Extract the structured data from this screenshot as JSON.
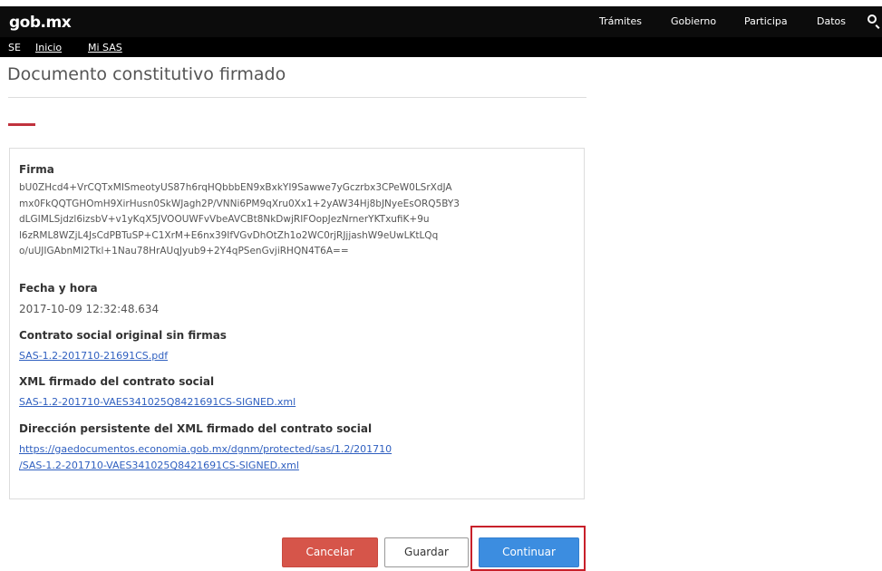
{
  "header": {
    "logo": "gob.mx",
    "nav": [
      "Trámites",
      "Gobierno",
      "Participa",
      "Datos"
    ],
    "search_icon": "search-icon"
  },
  "subheader": {
    "section": "SE",
    "links": [
      "Inicio",
      "Mi SAS"
    ]
  },
  "page": {
    "title": "Documento constitutivo firmado"
  },
  "card": {
    "firma_label": "Firma",
    "firma_value": "bU0ZHcd4+VrCQTxMISmeotyUS87h6rqHQbbbEN9xBxkYI9Sawwe7yGczrbx3CPeW0LSrXdJA\nmx0FkQQTGHOmH9XirHusn0SkWJagh2P/VNNi6PM9qXru0Xx1+2yAW34Hj8bJNyeEsORQ5BY3\ndLGIMLSjdzl6izsbV+v1yKqX5JVOOUWFvVbeAVCBt8NkDwjRIFOopJezNrnerYKTxufiK+9u\nl6zRML8WZjL4JsCdPBTuSP+C1XrM+E6nx39IfVGvDhOtZh1o2WC0rjRJjjashW9eUwLKtLQq\no/uUJIGAbnMI2Tkl+1Nau78HrAUqJyub9+2Y4qPSenGvjiRHQN4T6A==",
    "fecha_label": "Fecha y hora",
    "fecha_value": "2017-10-09 12:32:48.634",
    "contrato_label": "Contrato social original sin firmas",
    "contrato_link": "SAS-1.2-201710-21691CS.pdf",
    "xml_label": "XML firmado del contrato social",
    "xml_link": "SAS-1.2-201710-VAES341025Q8421691CS-SIGNED.xml",
    "direccion_label": "Dirección persistente del XML firmado del contrato social",
    "direccion_link": "https://gaedocumentos.economia.gob.mx/dgnm/protected/sas/1.2/201710\n/SAS-1.2-201710-VAES341025Q8421691CS-SIGNED.xml"
  },
  "buttons": {
    "cancel": "Cancelar",
    "save": "Guardar",
    "continue": "Continuar"
  },
  "colors": {
    "header_bg": "#0c0c0c",
    "accent_red": "#c0323d",
    "cancel_bg": "#d6554a",
    "continue_bg": "#3c8de0",
    "highlight_border": "#c8202a",
    "link": "#3060c0"
  }
}
